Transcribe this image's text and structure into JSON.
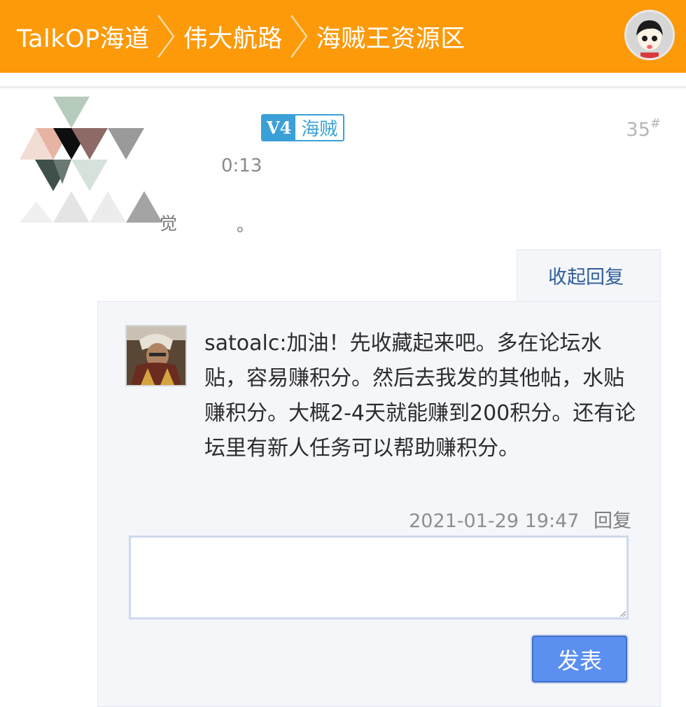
{
  "header": {
    "breadcrumbs": [
      "TalkOP海道",
      "伟大航路",
      "海贼王资源区"
    ],
    "user_avatar": "cartoon-avatar-icon"
  },
  "post": {
    "level_badge": {
      "icon": "V4",
      "rank": "海贼"
    },
    "floor": "35",
    "floor_mark": "#",
    "time_fragment": "0:13",
    "text_fragment_1": "觉",
    "text_fragment_2": "。"
  },
  "replies": {
    "collapse_label": "收起回复",
    "items": [
      {
        "author": "satoalc",
        "text": ":加油！先收藏起来吧。多在论坛水贴，容易赚积分。然后去我发的其他帖，水贴赚积分。大概2-4天就能赚到200积分。还有论坛里有新人任务可以帮助赚积分。",
        "timestamp": "2021-01-29 19:47",
        "reply_label": "回复"
      }
    ],
    "input_value": "",
    "submit_label": "发表"
  },
  "colors": {
    "header": "#fc9a0a",
    "link": "#2f5e99",
    "badge": "#3aa0d8",
    "button": "#5b8ff0",
    "panel": "#f4f6fa"
  }
}
